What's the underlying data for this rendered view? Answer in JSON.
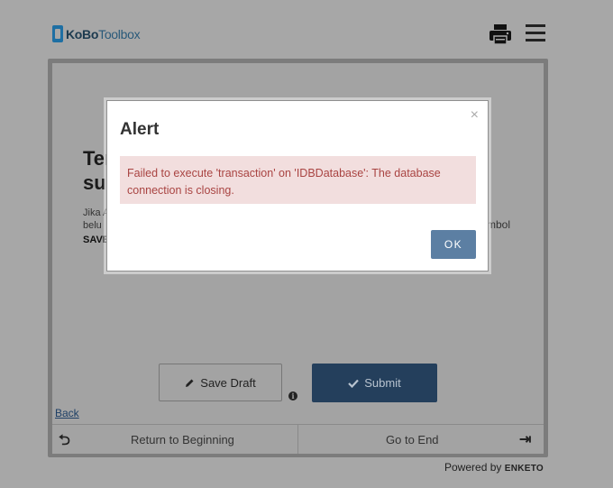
{
  "header": {
    "logo_part1": "KoBo",
    "logo_part2": "Toolbox",
    "print_icon": "printer-icon",
    "menu_icon": "hamburger-menu-icon"
  },
  "question": {
    "title_line1": "Ter",
    "title_line2": "su",
    "hint_line1": "Jika A",
    "hint_line2": "belu",
    "hint_line3": "SAVE",
    "hint_right": "mbol"
  },
  "actions": {
    "save_draft_label": "Save Draft",
    "submit_label": "Submit",
    "info_glyph": "i"
  },
  "navigation": {
    "back_label": "Back",
    "return_label": "Return to Beginning",
    "end_label": "Go to End"
  },
  "footer": {
    "powered_by": "Powered by",
    "brand": "ENKETO"
  },
  "modal": {
    "title": "Alert",
    "close_glyph": "×",
    "message": "Failed to execute 'transaction' on 'IDBDatabase': The database connection is closing.",
    "ok_label": "OK"
  },
  "colors": {
    "submit_bg": "#243f5c",
    "alert_bg": "#f2dede",
    "alert_text": "#a94442",
    "ok_bg": "#5c7fa3"
  }
}
